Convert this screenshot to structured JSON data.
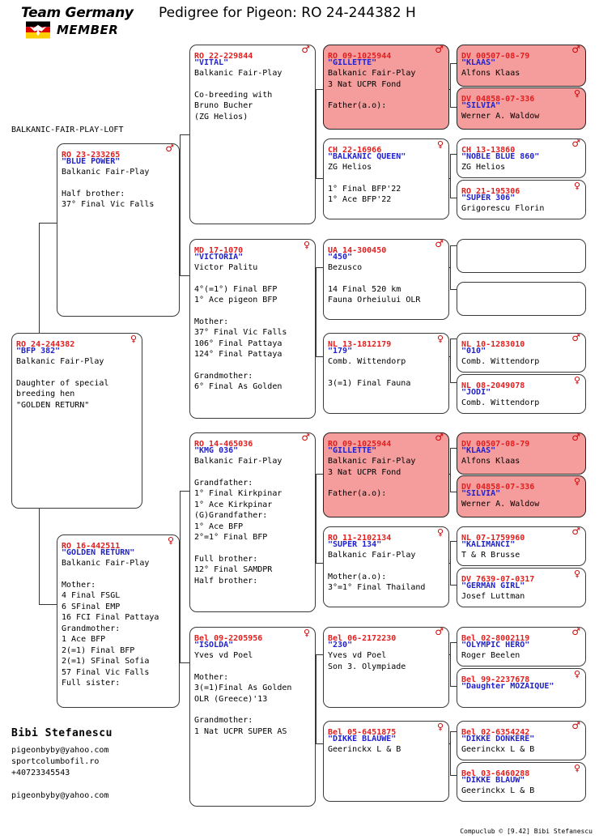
{
  "header": {
    "logo_line1": "Team Germany",
    "logo_line2": "MEMBER",
    "title": "Pedigree for Pigeon: RO  24-244382 H"
  },
  "loft_label": "BALKANIC-FAIR-PLAY-LOFT",
  "breeder": {
    "name": "Bibi Stefanescu",
    "email": "pigeonbyby@yahoo.com",
    "website": "sportcolumbofil.ro",
    "phone": "+40723345543",
    "email2": "pigeonbyby@yahoo.com"
  },
  "footer": "Compuclub © [9.42]  Bibi Stefanescu",
  "colors": {
    "ring_red": "#E02020",
    "nickname_blue": "#2222CC",
    "highlight_pink": "#F59C9C",
    "card_border": "#3a3a3a"
  },
  "icons": {
    "male": "male-symbol-icon",
    "female": "female-symbol-icon"
  },
  "cards": {
    "subject": {
      "ring": "RO  24-244382",
      "sex": "female",
      "nickname": "\"BFP 382\"",
      "lines": [
        "Balkanic Fair-Play",
        "",
        "Daughter of special",
        "breeding hen",
        "\"GOLDEN RETURN\""
      ],
      "pink": false
    },
    "g1_sire": {
      "ring": "RO  23-233265",
      "sex": "male",
      "nickname": "\"BLUE POWER\"",
      "lines": [
        "Balkanic Fair-Play",
        "",
        "Half brother:",
        "37° Final Vic Falls"
      ],
      "pink": false
    },
    "g1_dam": {
      "ring": "RO  16-442511",
      "sex": "female",
      "nickname": "\"GOLDEN RETURN\"",
      "lines": [
        "Balkanic Fair-Play",
        "",
        "Mother:",
        "4 Final FSGL",
        "6 SFinal EMP",
        "16 FCI Final Pattaya",
        "Grandmother:",
        "1 Ace BFP",
        "2(=1) Final BFP",
        "2(=1) SFinal Sofia",
        "57 Final Vic Falls",
        "Full sister:"
      ],
      "pink": false
    },
    "g2_a": {
      "ring": "RO  22-229844",
      "sex": "male",
      "nickname": "\"VITAL\"",
      "lines": [
        "Balkanic Fair-Play",
        "",
        "Co-breeding with",
        "Bruno Bucher",
        "(ZG Helios)"
      ],
      "pink": false
    },
    "g2_b": {
      "ring": "MD  17-1070",
      "sex": "female",
      "nickname": "\"VICTORIA\"",
      "lines": [
        "Victor Palitu",
        "",
        "4°(=1°) Final BFP",
        "1° Ace pigeon BFP",
        "",
        "Mother:",
        "37° Final Vic Falls",
        "106° Final Pattaya",
        "124° Final Pattaya",
        "",
        "Grandmother:",
        "6° Final As Golden"
      ],
      "pink": false
    },
    "g2_c": {
      "ring": "RO  14-465036",
      "sex": "male",
      "nickname": "\"KMG 036\"",
      "lines": [
        "Balkanic Fair-Play",
        "",
        "Grandfather:",
        "1° Final Kirkpinar",
        "1° Ace Kirkpinar",
        "(G)Grandfather:",
        "1° Ace BFP",
        "2°=1° Final BFP",
        "",
        "Full brother:",
        "12° Final SAMDPR",
        "Half brother:"
      ],
      "pink": false
    },
    "g2_d": {
      "ring": "Bel 09-2205956",
      "sex": "female",
      "nickname": "\"ISOLDA\"",
      "lines": [
        "Yves vd Poel",
        "",
        "Mother:",
        "3(=1)Final As Golden",
        "OLR (Greece)'13",
        "",
        "Grandmother:",
        "1 Nat UCPR SUPER AS"
      ],
      "pink": false
    },
    "g3_1": {
      "ring": "RO  09-1025944",
      "sex": "male",
      "nickname": "\"GILLETTE\"",
      "lines": [
        "Balkanic Fair-Play",
        "3 Nat UCPR Fond",
        "",
        "Father(a.o):"
      ],
      "pink": true
    },
    "g3_2": {
      "ring": "CH  22-16966",
      "sex": "female",
      "nickname": "\"BALKANIC QUEEN\"",
      "lines": [
        "ZG Helios",
        "",
        "1° Final BFP'22",
        "1° Ace BFP'22"
      ],
      "pink": false
    },
    "g3_3": {
      "ring": "UA  14-300450",
      "sex": "male",
      "nickname": "\"450\"",
      "lines": [
        "Bezusco",
        "",
        "14 Final 520 km",
        "Fauna Orheiului OLR"
      ],
      "pink": false
    },
    "g3_4": {
      "ring": "NL  13-1812179",
      "sex": "female",
      "nickname": "\"179\"",
      "lines": [
        "Comb. Wittendorp",
        "",
        "3(=1) Final Fauna"
      ],
      "pink": false
    },
    "g3_5": {
      "ring": "RO  09-1025944",
      "sex": "male",
      "nickname": "\"GILLETTE\"",
      "lines": [
        "Balkanic Fair-Play",
        "3 Nat UCPR Fond",
        "",
        "Father(a.o):"
      ],
      "pink": true
    },
    "g3_6": {
      "ring": "RO  11-2102134",
      "sex": "female",
      "nickname": "\"SUPER 134\"",
      "lines": [
        "Balkanic Fair-Play",
        "",
        "Mother(a.o):",
        "3°=1° Final Thailand"
      ],
      "pink": false
    },
    "g3_7": {
      "ring": "Bel 06-2172230",
      "sex": "male",
      "nickname": "\"230\"",
      "lines": [
        "Yves vd Poel",
        "Son 3. Olympiade"
      ],
      "pink": false
    },
    "g3_8": {
      "ring": "Bel 05-6451875",
      "sex": "female",
      "nickname": "\"DIKKE BLAUWE\"",
      "lines": [
        "Geerinckx L & B"
      ],
      "pink": false
    },
    "g4_1": {
      "ring": "DV  00507-08-79",
      "sex": "male",
      "nickname": "\"KLAAS\"",
      "lines": [
        "Alfons Klaas"
      ],
      "pink": true
    },
    "g4_2": {
      "ring": "DV  04858-07-336",
      "sex": "female",
      "nickname": "\"SILVIA\"",
      "lines": [
        "Werner A. Waldow"
      ],
      "pink": true
    },
    "g4_3": {
      "ring": "CH  13-13860",
      "sex": "male",
      "nickname": "\"NOBLE BLUE 860\"",
      "lines": [
        "ZG Helios"
      ],
      "pink": false
    },
    "g4_4": {
      "ring": "RO  21-195306",
      "sex": "female",
      "nickname": "\"SUPER 306\"",
      "lines": [
        "Grigorescu Florin"
      ],
      "pink": false
    },
    "g4_5": {
      "ring": "",
      "sex": "",
      "nickname": "",
      "lines": [],
      "pink": false
    },
    "g4_6": {
      "ring": "",
      "sex": "",
      "nickname": "",
      "lines": [],
      "pink": false
    },
    "g4_7": {
      "ring": "NL  10-1283010",
      "sex": "male",
      "nickname": "\"010\"",
      "lines": [
        "Comb. Wittendorp"
      ],
      "pink": false
    },
    "g4_8": {
      "ring": "NL  08-2049078",
      "sex": "female",
      "nickname": "\"JODI\"",
      "lines": [
        "Comb. Wittendorp"
      ],
      "pink": false
    },
    "g4_9": {
      "ring": "DV  00507-08-79",
      "sex": "male",
      "nickname": "\"KLAAS\"",
      "lines": [
        "Alfons Klaas"
      ],
      "pink": true
    },
    "g4_10": {
      "ring": "DV  04858-07-336",
      "sex": "female",
      "nickname": "\"SILVIA\"",
      "lines": [
        "Werner A. Waldow"
      ],
      "pink": true
    },
    "g4_11": {
      "ring": "NL  07-1759960",
      "sex": "male",
      "nickname": "\"KALIMANCI\"",
      "lines": [
        "T & R Brusse"
      ],
      "pink": false
    },
    "g4_12": {
      "ring": "DV  7639-07-0317",
      "sex": "female",
      "nickname": "\"GERMAN GIRL\"",
      "lines": [
        "Josef Luttman"
      ],
      "pink": false
    },
    "g4_13": {
      "ring": "Bel 02-8002119",
      "sex": "male",
      "nickname": "\"OLYMPIC HERO\"",
      "lines": [
        "Roger Beelen"
      ],
      "pink": false
    },
    "g4_14": {
      "ring": "Bel 99-2237678",
      "sex": "female",
      "nickname": "\"Daughter MOZAIQUE\"",
      "lines": [],
      "pink": false
    },
    "g4_15": {
      "ring": "Bel 02-6354242",
      "sex": "male",
      "nickname": "\"DIKKE DONKERE\"",
      "lines": [
        "Geerinckx L & B"
      ],
      "pink": false
    },
    "g4_16": {
      "ring": "Bel 03-6460288",
      "sex": "female",
      "nickname": "\"DIKKE BLAUW\"",
      "lines": [
        "Geerinckx L & B"
      ],
      "pink": false
    }
  }
}
